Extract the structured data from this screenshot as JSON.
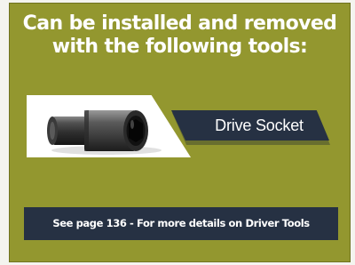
{
  "title": {
    "line1": "Can be installed and removed",
    "line2": "with the following tools:"
  },
  "tool": {
    "label": "Drive Socket",
    "icon": "drive-socket-icon"
  },
  "footer": {
    "text": "See page 136 - For more details on Driver Tools"
  },
  "colors": {
    "panel": "#93972f",
    "label_bg": "#263143",
    "text": "#ffffff"
  }
}
